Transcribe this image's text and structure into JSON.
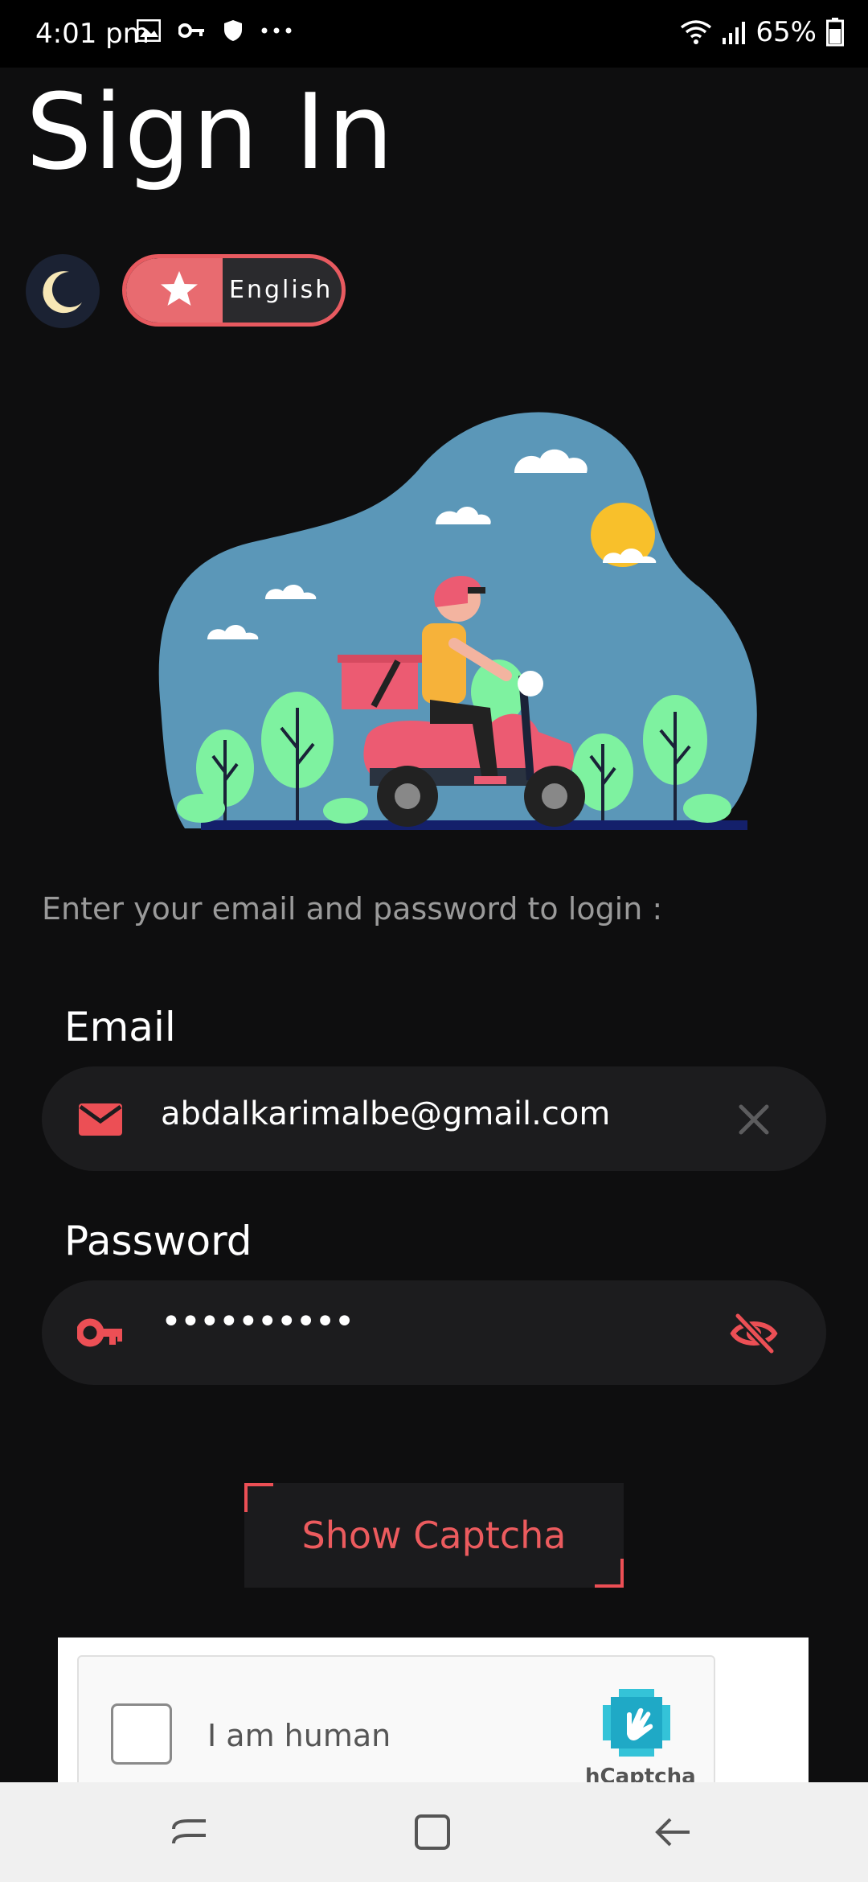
{
  "status_bar": {
    "time": "4:01 pm",
    "battery": "65%",
    "icons": [
      "image-icon",
      "key-icon",
      "shield-icon",
      "more-dots-icon",
      "wifi-icon",
      "signal-icon",
      "battery-icon"
    ]
  },
  "page": {
    "title": "Sign In",
    "theme_toggle_icon": "moon-icon",
    "language_toggle": {
      "label": "English",
      "icon": "star-icon"
    },
    "illustration": "delivery-scooter-illustration",
    "subtitle": "Enter your email and password to login :"
  },
  "email": {
    "label": "Email",
    "value": "abdalkarimalbe@gmail.com",
    "lead_icon": "mail-icon",
    "trail_icon": "clear-icon"
  },
  "password": {
    "label": "Password",
    "value": "••••••••••",
    "lead_icon": "key-icon",
    "trail_icon": "eye-off-icon"
  },
  "captcha": {
    "button_label": "Show Captcha",
    "checkbox_label": "I am human",
    "brand": "hCaptcha"
  },
  "colors": {
    "accent": "#e85a60",
    "background": "#0e0e0f",
    "field_bg": "#1c1c1e",
    "sky": "#5b97b8"
  }
}
